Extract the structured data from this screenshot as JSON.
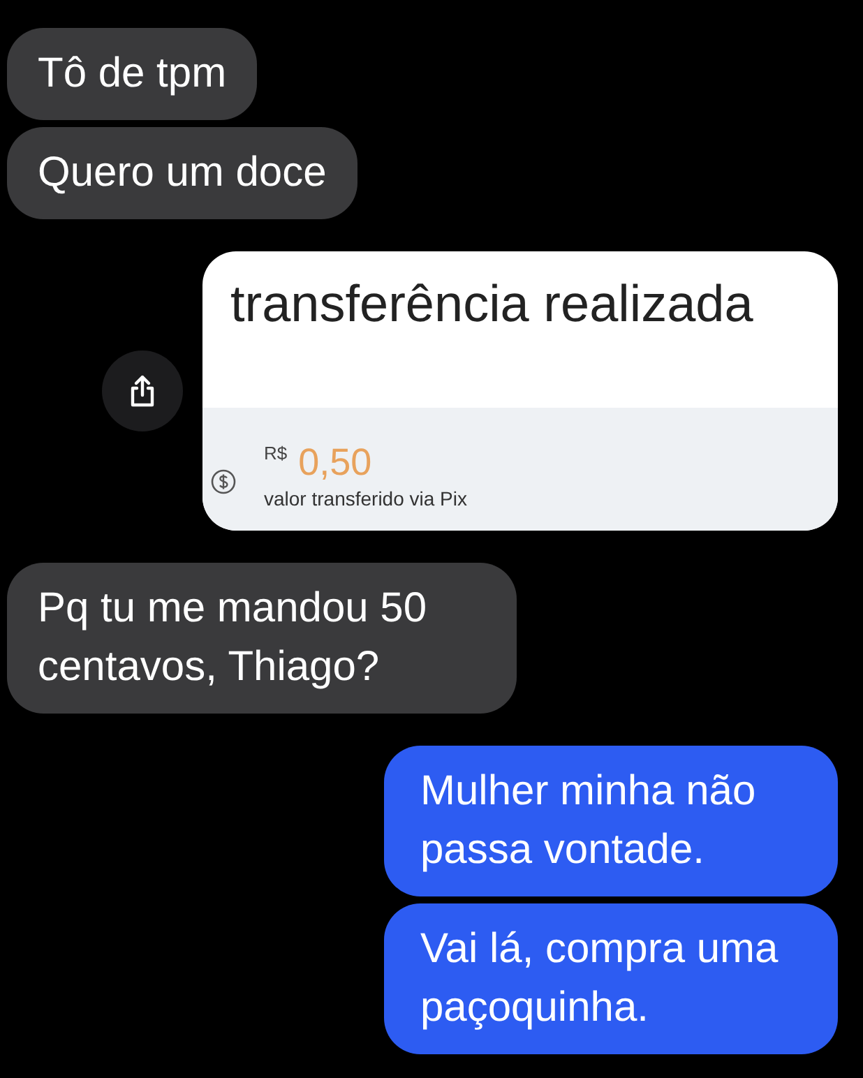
{
  "messages": [
    {
      "kind": "text",
      "outgoing": false,
      "text": "Tô de tpm"
    },
    {
      "kind": "text",
      "outgoing": false,
      "text": "Quero um doce"
    },
    {
      "kind": "transfer",
      "outgoing": true,
      "title": "transferência realizada",
      "currency": "R$",
      "amount": "0,50",
      "caption": "valor transferido via Pix"
    },
    {
      "kind": "text",
      "outgoing": false,
      "text": "Pq tu me mandou 50 centavos, Thiago?"
    },
    {
      "kind": "text",
      "outgoing": true,
      "text": "Mulher minha não passa vontade."
    },
    {
      "kind": "text",
      "outgoing": true,
      "text": "Vai lá, compra uma paçoquinha."
    }
  ]
}
